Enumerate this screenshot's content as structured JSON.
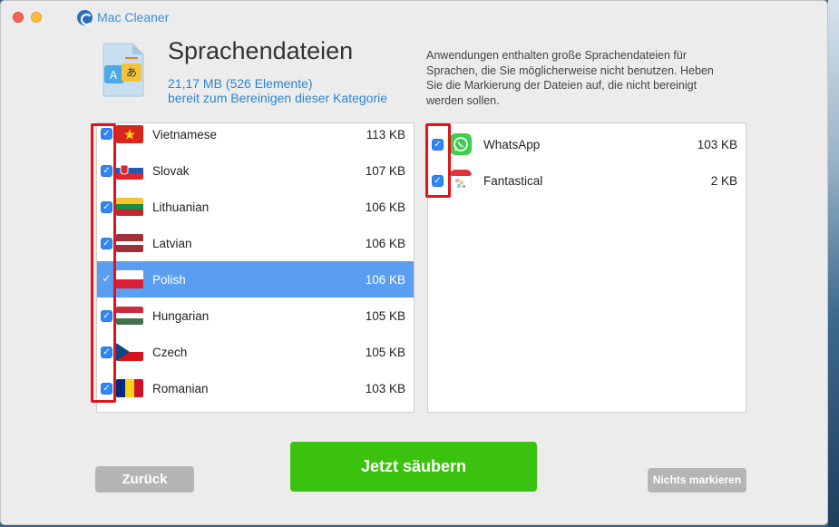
{
  "window": {
    "app_title": "Mac Cleaner"
  },
  "category": {
    "title": "Sprachendateien",
    "size_line": "21,17 MB (526 Elemente)",
    "status_line": "bereit zum Bereinigen dieser Kategorie",
    "description": "Anwendungen enthalten große Sprachendateien für Sprachen, die Sie möglicherweise nicht benutzen. Heben Sie die Markierung der Dateien auf, die nicht bereinigt werden sollen.",
    "icon_text_left": "A",
    "icon_text_right": "あ"
  },
  "languages": [
    {
      "name": "Vietnamese",
      "size": "113 KB",
      "checked": true,
      "flag": "vietnam-flag-icon"
    },
    {
      "name": "Slovak",
      "size": "107 KB",
      "checked": true,
      "flag": "slovakia-flag-icon"
    },
    {
      "name": "Lithuanian",
      "size": "106 KB",
      "checked": true,
      "flag": "lithuania-flag-icon"
    },
    {
      "name": "Latvian",
      "size": "106 KB",
      "checked": true,
      "flag": "latvia-flag-icon"
    },
    {
      "name": "Polish",
      "size": "106 KB",
      "checked": true,
      "selected": true,
      "flag": "poland-flag-icon"
    },
    {
      "name": "Hungarian",
      "size": "105 KB",
      "checked": true,
      "flag": "hungary-flag-icon"
    },
    {
      "name": "Czech",
      "size": "105 KB",
      "checked": true,
      "flag": "czech-flag-icon"
    },
    {
      "name": "Romanian",
      "size": "103 KB",
      "checked": true,
      "flag": "romania-flag-icon"
    }
  ],
  "apps": [
    {
      "name": "WhatsApp",
      "size": "103 KB",
      "checked": true,
      "icon": "whatsapp-icon"
    },
    {
      "name": "Fantastical",
      "size": "2 KB",
      "checked": true,
      "icon": "fantastical-icon"
    }
  ],
  "buttons": {
    "back": "Zurück",
    "clean": "Jetzt säubern",
    "unmark": "Nichts markieren"
  },
  "colors": {
    "accent": "#2c86cf",
    "selection": "#5a9ef1",
    "primary_button": "#3bc20e",
    "highlight_box": "#e0141a"
  }
}
